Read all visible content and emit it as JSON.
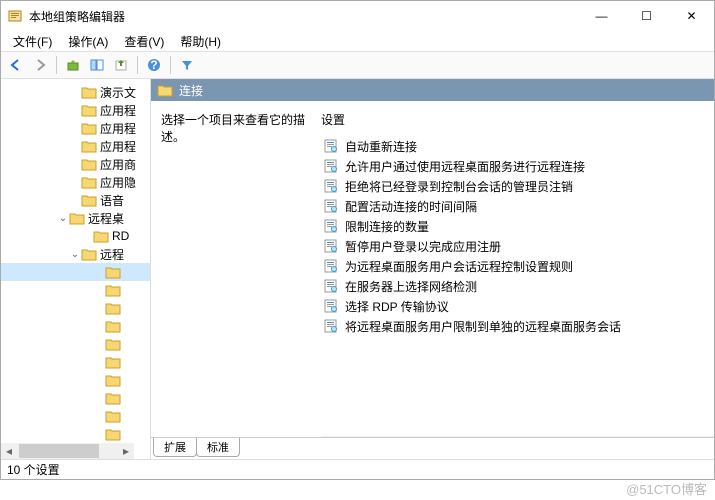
{
  "window": {
    "title": "本地组策略编辑器",
    "minimize": "—",
    "maximize": "☐",
    "close": "✕"
  },
  "menu": {
    "file": "文件(F)",
    "action": "操作(A)",
    "view": "查看(V)",
    "help": "帮助(H)"
  },
  "tree": {
    "items": [
      {
        "indent": 68,
        "label": "演示文",
        "exp": ""
      },
      {
        "indent": 68,
        "label": "应用程",
        "exp": ""
      },
      {
        "indent": 68,
        "label": "应用程",
        "exp": ""
      },
      {
        "indent": 68,
        "label": "应用程",
        "exp": ""
      },
      {
        "indent": 68,
        "label": "应用商",
        "exp": ""
      },
      {
        "indent": 68,
        "label": "应用隐",
        "exp": ""
      },
      {
        "indent": 68,
        "label": "语音",
        "exp": ""
      },
      {
        "indent": 56,
        "label": "远程桌",
        "exp": "⌄"
      },
      {
        "indent": 80,
        "label": "RD",
        "exp": ""
      },
      {
        "indent": 68,
        "label": "远程",
        "exp": "⌄"
      },
      {
        "indent": 92,
        "label": "",
        "exp": "",
        "sel": true
      },
      {
        "indent": 92,
        "label": "",
        "exp": ""
      },
      {
        "indent": 92,
        "label": "",
        "exp": ""
      },
      {
        "indent": 92,
        "label": "",
        "exp": ""
      },
      {
        "indent": 92,
        "label": "",
        "exp": ""
      },
      {
        "indent": 92,
        "label": "",
        "exp": ""
      },
      {
        "indent": 92,
        "label": "",
        "exp": ""
      },
      {
        "indent": 92,
        "label": "",
        "exp": ""
      },
      {
        "indent": 92,
        "label": "",
        "exp": ""
      },
      {
        "indent": 92,
        "label": "",
        "exp": ""
      },
      {
        "indent": 92,
        "label": "",
        "exp": ""
      }
    ]
  },
  "header": {
    "label": "连接"
  },
  "desc": {
    "prompt": "选择一个项目来查看它的描述。"
  },
  "settings": {
    "column": "设置",
    "items": [
      "自动重新连接",
      "允许用户通过使用远程桌面服务进行远程连接",
      "拒绝将已经登录到控制台会话的管理员注销",
      "配置活动连接的时间间隔",
      "限制连接的数量",
      "暂停用户登录以完成应用注册",
      "为远程桌面服务用户会话远程控制设置规则",
      "在服务器上选择网络检测",
      "选择 RDP 传输协议",
      "将远程桌面服务用户限制到单独的远程桌面服务会话"
    ]
  },
  "tabs": {
    "extended": "扩展",
    "standard": "标准"
  },
  "status": {
    "text": "10 个设置"
  },
  "watermark": "@51CTO博客"
}
